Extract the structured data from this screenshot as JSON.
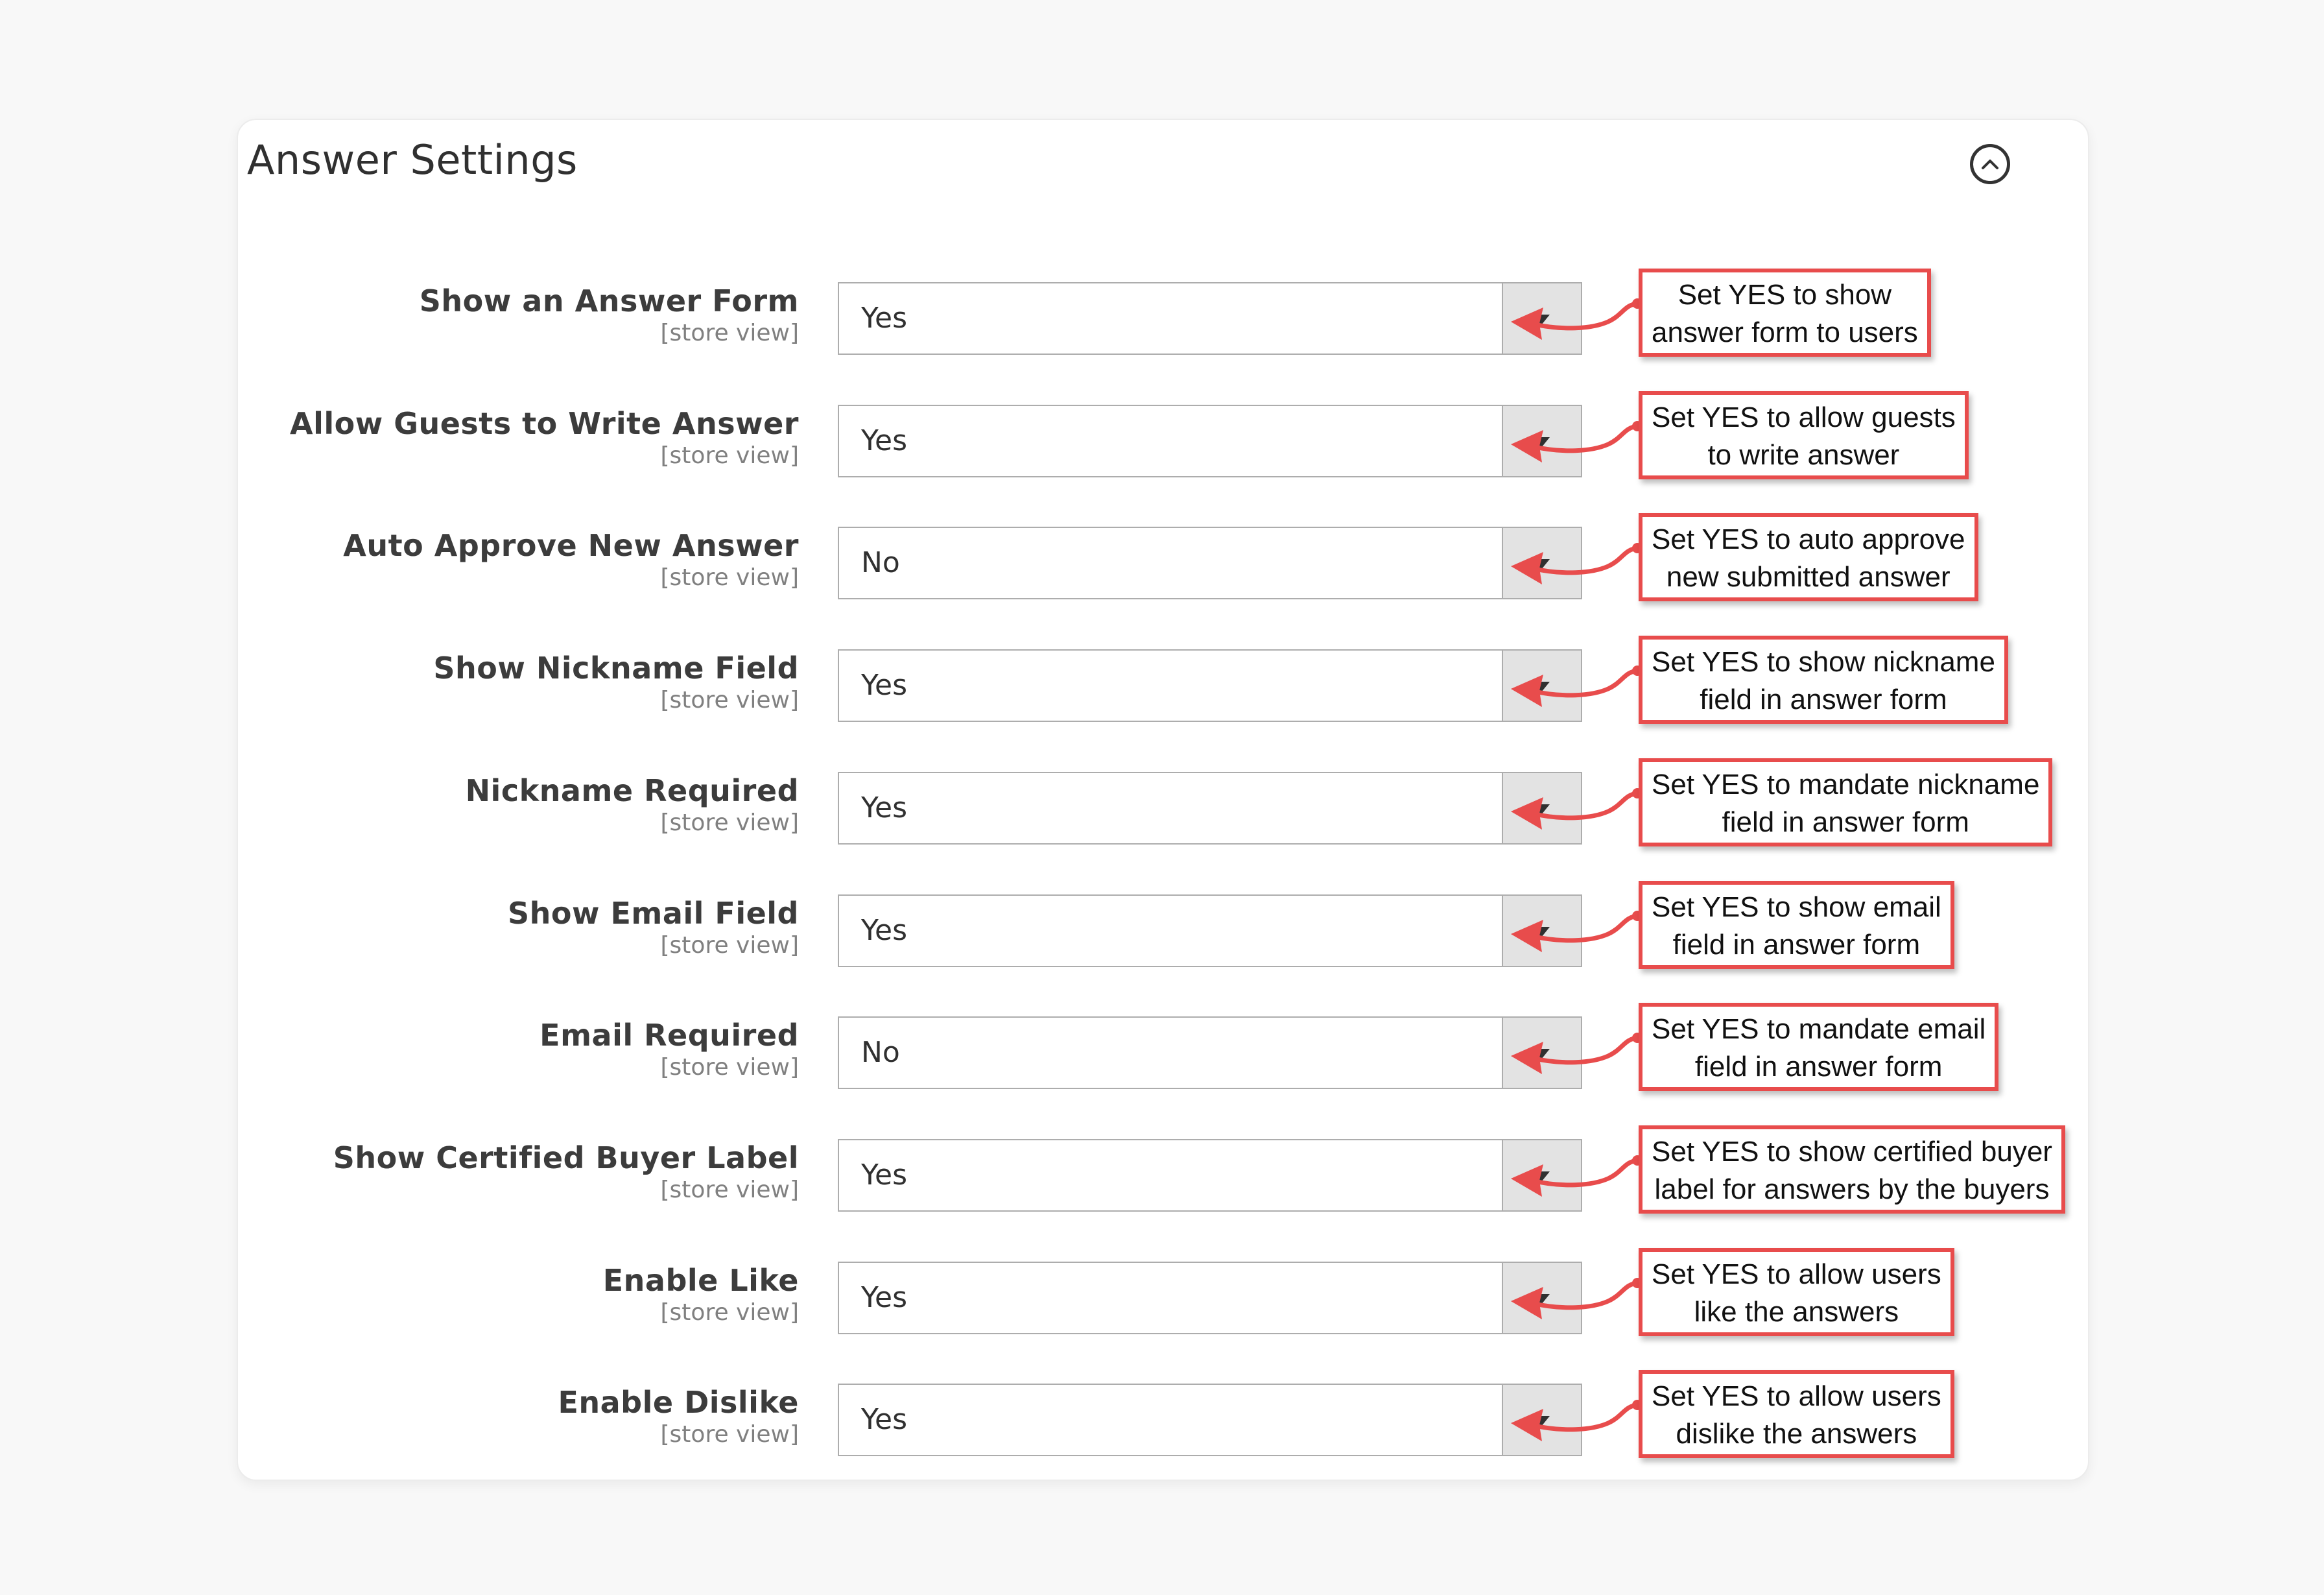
{
  "panel": {
    "title": "Answer Settings",
    "collapse_icon": "chevron-up-circle-icon"
  },
  "rows": [
    {
      "label": "Show an Answer Form",
      "scope": "[store view]",
      "value": "Yes",
      "callout": [
        "Set YES to show",
        "answer form to users"
      ]
    },
    {
      "label": "Allow Guests to Write Answer",
      "scope": "[store view]",
      "value": "Yes",
      "callout": [
        "Set YES to allow guests",
        "to write answer"
      ]
    },
    {
      "label": "Auto Approve New Answer",
      "scope": "[store view]",
      "value": "No",
      "callout": [
        "Set YES to auto approve",
        "new submitted answer"
      ]
    },
    {
      "label": "Show Nickname Field",
      "scope": "[store view]",
      "value": "Yes",
      "callout": [
        "Set YES to show nickname",
        "field in answer form"
      ]
    },
    {
      "label": "Nickname Required",
      "scope": "[store view]",
      "value": "Yes",
      "callout": [
        "Set YES to mandate nickname",
        "field in answer form"
      ]
    },
    {
      "label": "Show Email Field",
      "scope": "[store view]",
      "value": "Yes",
      "callout": [
        "Set YES to show email",
        "field in answer form"
      ]
    },
    {
      "label": "Email Required",
      "scope": "[store view]",
      "value": "No",
      "callout": [
        "Set YES to mandate email",
        "field in answer form"
      ]
    },
    {
      "label": "Show Certified Buyer Label",
      "scope": "[store view]",
      "value": "Yes",
      "callout": [
        "Set YES to show certified buyer",
        "label for answers by the buyers"
      ]
    },
    {
      "label": "Enable Like",
      "scope": "[store view]",
      "value": "Yes",
      "callout": [
        "Set YES to allow users",
        "like the answers"
      ]
    },
    {
      "label": "Enable Dislike",
      "scope": "[store view]",
      "value": "Yes",
      "callout": [
        "Set YES to allow users",
        "dislike the answers"
      ]
    }
  ],
  "colors": {
    "callout_border": "#e84c4c",
    "select_arrow_bg": "#e3e3e3"
  }
}
